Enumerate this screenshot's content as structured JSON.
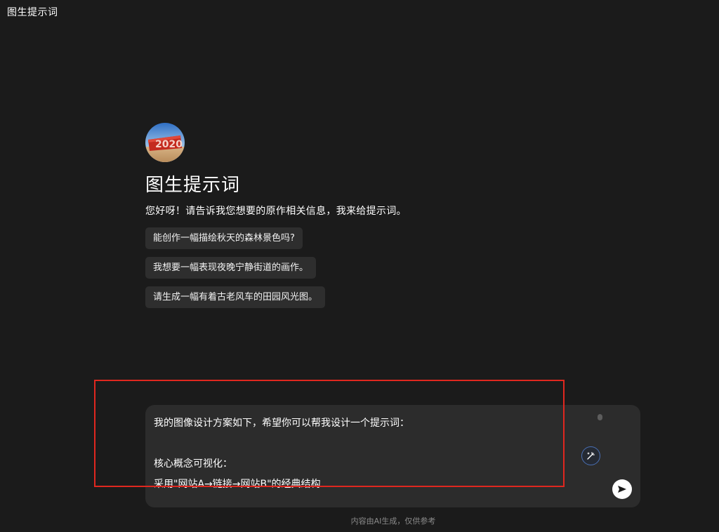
{
  "window": {
    "title": "图生提示词"
  },
  "bot": {
    "name": "图生提示词",
    "greeting": "您好呀！请告诉我您想要的原作相关信息，我来给提示词。",
    "avatar_icon": "red-2020-sculpture-avatar"
  },
  "suggestions": [
    {
      "label": "能创作一幅描绘秋天的森林景色吗?"
    },
    {
      "label": "我想要一幅表现夜晚宁静街道的画作。"
    },
    {
      "label": "请生成一幅有着古老风车的田园风光图。"
    }
  ],
  "composer": {
    "text": "我的图像设计方案如下，希望你可以帮我设计一个提示词：\n\n核心概念可视化：\n采用\"网站A→链接→网站B\"的经典结构",
    "optimize_icon": "magic-wand-icon",
    "send_icon": "send-arrow-icon"
  },
  "footer": {
    "disclaimer": "内容由AI生成，仅供参考"
  },
  "colors": {
    "background": "#1b1b1b",
    "chip": "#2e2e2e",
    "composer": "#2c2c2c",
    "annotation": "#e0271f",
    "accent_ring": "#4a6fb3"
  }
}
